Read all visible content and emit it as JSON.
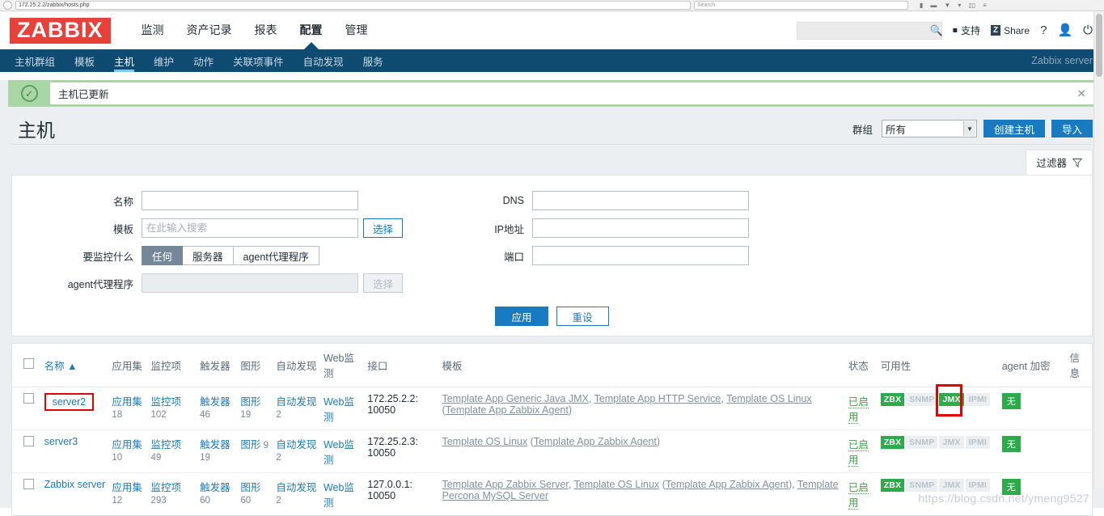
{
  "browser": {
    "url": "172.25.2.2/zabbix/hosts.php",
    "search_placeholder": "Search"
  },
  "header": {
    "logo": "ZABBIX",
    "menu": [
      {
        "label": "监测",
        "selected": false
      },
      {
        "label": "资产记录",
        "selected": false
      },
      {
        "label": "报表",
        "selected": false
      },
      {
        "label": "配置",
        "selected": true
      },
      {
        "label": "管理",
        "selected": false
      }
    ],
    "search_value": "",
    "support_label": "支持",
    "share_label": "Share",
    "share_badge": "Z",
    "help_icon": "?",
    "user_icon": "user-icon",
    "signout_icon": "power-icon"
  },
  "subnav": {
    "items": [
      {
        "label": "主机群组",
        "selected": false
      },
      {
        "label": "模板",
        "selected": false
      },
      {
        "label": "主机",
        "selected": true
      },
      {
        "label": "维护",
        "selected": false
      },
      {
        "label": "动作",
        "selected": false
      },
      {
        "label": "关联项事件",
        "selected": false
      },
      {
        "label": "自动发现",
        "selected": false
      },
      {
        "label": "服务",
        "selected": false
      }
    ],
    "server": "Zabbix server"
  },
  "message": {
    "text": "主机已更新",
    "close": "✕",
    "color": "#a9d6a5"
  },
  "title": {
    "page_title": "主机",
    "group_label": "群组",
    "group_value": "所有",
    "create_button": "创建主机",
    "import_button": "导入"
  },
  "filter": {
    "tab_label": "过滤器",
    "name_label": "名称",
    "name_value": "",
    "template_label": "模板",
    "template_placeholder": "在此输入搜索",
    "template_select_button": "选择",
    "monitored_by_label": "要监控什么",
    "monitored_by_options": [
      "任何",
      "服务器",
      "agent代理程序"
    ],
    "monitored_by_selected": "任何",
    "proxy_label": "agent代理程序",
    "proxy_value": "",
    "proxy_select_button": "选择",
    "dns_label": "DNS",
    "dns_value": "",
    "ip_label": "IP地址",
    "ip_value": "",
    "port_label": "端口",
    "port_value": "",
    "apply_button": "应用",
    "reset_button": "重设"
  },
  "table": {
    "columns": {
      "name": "名称",
      "sort_arrow": "▲",
      "applications": "应用集",
      "items": "监控项",
      "triggers": "触发器",
      "graphs": "图形",
      "discovery": "自动发现",
      "web": "Web监测",
      "interface": "接口",
      "templates": "模板",
      "status": "状态",
      "availability": "可用性",
      "encryption": "agent 加密",
      "info": "信息"
    },
    "rows": [
      {
        "name": "server2",
        "highlighted": true,
        "applications_label": "应用集",
        "applications_count": "18",
        "items_label": "监控项",
        "items_count": "102",
        "triggers_label": "触发器",
        "triggers_count": "46",
        "graphs_label": "图形",
        "graphs_count": "19",
        "discovery_label": "自动发现",
        "discovery_count": "2",
        "web_label": "Web监测",
        "interface": "172.25.2.2: 10050",
        "templates": [
          {
            "text": "Template App Generic Java JMX",
            "sep": ", "
          },
          {
            "text": "Template App HTTP Service",
            "sep": ", "
          },
          {
            "text": "Template OS Linux",
            "sep": " ("
          },
          {
            "text": "Template App Zabbix Agent",
            "sep": ")"
          }
        ],
        "status": "已启用",
        "availability": [
          {
            "label": "ZBX",
            "on": true,
            "highlight": false
          },
          {
            "label": "SNMP",
            "on": false,
            "highlight": false
          },
          {
            "label": "JMX",
            "on": true,
            "highlight": true
          },
          {
            "label": "IPMI",
            "on": false,
            "highlight": false
          }
        ],
        "encryption": "无",
        "info": ""
      },
      {
        "name": "server3",
        "highlighted": false,
        "applications_label": "应用集",
        "applications_count": "10",
        "items_label": "监控项",
        "items_count": "49",
        "triggers_label": "触发器",
        "triggers_count": "19",
        "graphs_label": "图形",
        "graphs_count": "9",
        "discovery_label": "自动发现",
        "discovery_count": "2",
        "web_label": "Web监测",
        "interface": "172.25.2.3: 10050",
        "templates": [
          {
            "text": "Template OS Linux",
            "sep": " ("
          },
          {
            "text": "Template App Zabbix Agent",
            "sep": ")"
          }
        ],
        "status": "已启用",
        "availability": [
          {
            "label": "ZBX",
            "on": true,
            "highlight": false
          },
          {
            "label": "SNMP",
            "on": false,
            "highlight": false
          },
          {
            "label": "JMX",
            "on": false,
            "highlight": false
          },
          {
            "label": "IPMI",
            "on": false,
            "highlight": false
          }
        ],
        "encryption": "无",
        "info": ""
      },
      {
        "name": "Zabbix server",
        "highlighted": false,
        "applications_label": "应用集",
        "applications_count": "12",
        "items_label": "监控项",
        "items_count": "293",
        "triggers_label": "触发器",
        "triggers_count": "60",
        "graphs_label": "图形",
        "graphs_count": "60",
        "discovery_label": "自动发现",
        "discovery_count": "2",
        "web_label": "Web监测",
        "interface": "127.0.0.1: 10050",
        "templates": [
          {
            "text": "Template App Zabbix Server",
            "sep": ", "
          },
          {
            "text": "Template OS Linux",
            "sep": " ("
          },
          {
            "text": "Template App Zabbix Agent",
            "sep": "), "
          },
          {
            "text": "Template Percona MySQL Server",
            "sep": ""
          }
        ],
        "status": "已启用",
        "availability": [
          {
            "label": "ZBX",
            "on": true,
            "highlight": false
          },
          {
            "label": "SNMP",
            "on": false,
            "highlight": false
          },
          {
            "label": "JMX",
            "on": false,
            "highlight": false
          },
          {
            "label": "IPMI",
            "on": false,
            "highlight": false
          }
        ],
        "encryption": "无",
        "info": ""
      }
    ]
  },
  "watermark": "https://blog.csdn.net/ymeng9527",
  "colors": {
    "brand_red": "#e8403a",
    "nav_blue": "#0f4a70",
    "link_blue": "#1a7ac0",
    "green": "#2bab4a",
    "highlight_red": "#e30000"
  }
}
